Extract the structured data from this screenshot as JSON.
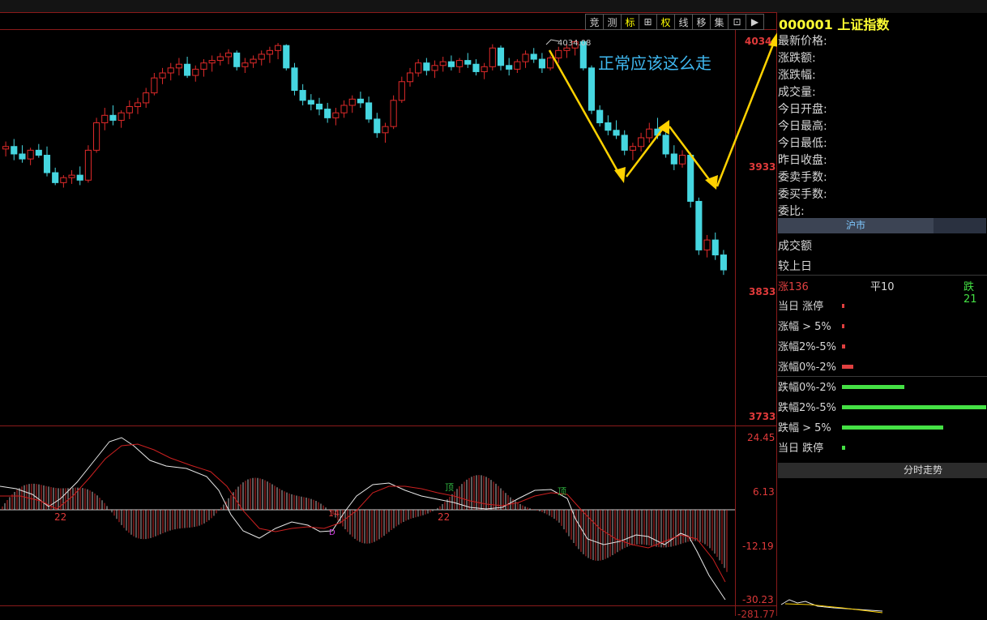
{
  "toolbar": {
    "buttons": [
      {
        "label": "竞",
        "active": false
      },
      {
        "label": "测",
        "active": false
      },
      {
        "label": "标",
        "active": true
      },
      {
        "label": "⊞",
        "active": false
      },
      {
        "label": "权",
        "active": true
      },
      {
        "label": "线",
        "active": false
      },
      {
        "label": "移",
        "active": false
      },
      {
        "label": "集",
        "active": false
      },
      {
        "label": "⊡",
        "active": false
      },
      {
        "label": "▶",
        "active": false
      }
    ]
  },
  "main_chart": {
    "price_axis": [
      "4034",
      "3933",
      "3833",
      "3733"
    ],
    "high_label": "4034.08",
    "annotation": "正常应该这么走"
  },
  "indicator": {
    "axis": [
      "24.45",
      "6.13",
      "-12.19",
      "-30.23",
      "-281.77"
    ],
    "markers": [
      "22",
      "14",
      "22",
      "D",
      "顶",
      "顶"
    ]
  },
  "panel": {
    "code": "000001",
    "name": "上证指数",
    "fields": [
      "最新价格:",
      "涨跌额:",
      "涨跌幅:",
      "成交量:",
      "今日开盘:",
      "今日最高:",
      "今日最低:",
      "昨日收盘:",
      "委卖手数:",
      "委买手数:",
      "委比:"
    ],
    "market_tab": "沪市",
    "turnover_label": "成交额",
    "compare_label": "较上日",
    "up_label": "涨136",
    "flat_label": "平10",
    "down_label": "跌21",
    "distribution": [
      {
        "label": "当日 涨停",
        "value": 1,
        "color": "#e04040"
      },
      {
        "label": "涨幅 > 5%",
        "value": 1,
        "color": "#e04040"
      },
      {
        "label": "涨幅2%-5%",
        "value": 4,
        "color": "#e04040"
      },
      {
        "label": "涨幅0%-2%",
        "value": 14,
        "color": "#e04040"
      },
      {
        "label": "跌幅0%-2%",
        "value": 78,
        "color": "#44e044"
      },
      {
        "label": "跌幅2%-5%",
        "value": 180,
        "color": "#44e044"
      },
      {
        "label": "跌幅 > 5%",
        "value": 126,
        "color": "#44e044"
      },
      {
        "label": "当日 跌停",
        "value": 4,
        "color": "#44e044"
      }
    ],
    "fenshi_label": "分时走势"
  },
  "colors": {
    "up": "#e02a2a",
    "down": "#46d6e0",
    "annotation_line": "#ffd200"
  },
  "chart_data": {
    "type": "candlestick",
    "title": "",
    "ylim": [
      3733,
      4034
    ],
    "y_ticks": [
      4034,
      3933,
      3833,
      3733
    ],
    "high": 4034.08,
    "candles": [
      [
        3947,
        3953,
        3941,
        3949
      ],
      [
        3949,
        3955,
        3938,
        3943
      ],
      [
        3943,
        3950,
        3936,
        3939
      ],
      [
        3939,
        3948,
        3934,
        3946
      ],
      [
        3946,
        3951,
        3940,
        3942
      ],
      [
        3942,
        3949,
        3925,
        3928
      ],
      [
        3928,
        3932,
        3918,
        3920
      ],
      [
        3920,
        3926,
        3916,
        3924
      ],
      [
        3924,
        3930,
        3919,
        3926
      ],
      [
        3926,
        3933,
        3918,
        3922
      ],
      [
        3922,
        3950,
        3920,
        3946
      ],
      [
        3946,
        3972,
        3944,
        3968
      ],
      [
        3968,
        3980,
        3962,
        3974
      ],
      [
        3974,
        3982,
        3966,
        3970
      ],
      [
        3970,
        3978,
        3964,
        3976
      ],
      [
        3976,
        3986,
        3971,
        3981
      ],
      [
        3981,
        3988,
        3975,
        3984
      ],
      [
        3984,
        3996,
        3980,
        3992
      ],
      [
        3992,
        4008,
        3990,
        4004
      ],
      [
        4004,
        4012,
        3999,
        4008
      ],
      [
        4008,
        4016,
        4002,
        4012
      ],
      [
        4012,
        4020,
        4006,
        4015
      ],
      [
        4015,
        4021,
        4004,
        4006
      ],
      [
        4006,
        4014,
        4001,
        4011
      ],
      [
        4011,
        4019,
        4005,
        4016
      ],
      [
        4016,
        4022,
        4009,
        4018
      ],
      [
        4018,
        4024,
        4014,
        4021
      ],
      [
        4021,
        4027,
        4015,
        4024
      ],
      [
        4024,
        4026,
        4010,
        4013
      ],
      [
        4013,
        4020,
        4008,
        4016
      ],
      [
        4016,
        4022,
        4012,
        4019
      ],
      [
        4019,
        4026,
        4014,
        4023
      ],
      [
        4023,
        4029,
        4016,
        4026
      ],
      [
        4026,
        4032,
        4019,
        4030
      ],
      [
        4030,
        4031,
        4010,
        4012
      ],
      [
        4012,
        4016,
        3990,
        3994
      ],
      [
        3994,
        3999,
        3982,
        3986
      ],
      [
        3986,
        3991,
        3978,
        3983
      ],
      [
        3983,
        3988,
        3974,
        3979
      ],
      [
        3979,
        3984,
        3968,
        3972
      ],
      [
        3972,
        3980,
        3966,
        3976
      ],
      [
        3976,
        3986,
        3972,
        3982
      ],
      [
        3982,
        3990,
        3976,
        3987
      ],
      [
        3987,
        3993,
        3980,
        3984
      ],
      [
        3984,
        3989,
        3968,
        3971
      ],
      [
        3971,
        3976,
        3956,
        3960
      ],
      [
        3960,
        3968,
        3952,
        3965
      ],
      [
        3965,
        3990,
        3963,
        3986
      ],
      [
        3986,
        4005,
        3984,
        4001
      ],
      [
        4001,
        4012,
        3997,
        4008
      ],
      [
        4008,
        4019,
        4005,
        4016
      ],
      [
        4016,
        4020,
        4006,
        4010
      ],
      [
        4010,
        4018,
        4004,
        4014
      ],
      [
        4014,
        4021,
        4009,
        4017
      ],
      [
        4017,
        4022,
        4010,
        4013
      ],
      [
        4013,
        4020,
        4008,
        4018
      ],
      [
        4018,
        4024,
        4012,
        4015
      ],
      [
        4015,
        4019,
        4006,
        4009
      ],
      [
        4009,
        4016,
        4003,
        4013
      ],
      [
        4013,
        4031,
        4010,
        4028
      ],
      [
        4028,
        4030,
        4010,
        4014
      ],
      [
        4014,
        4020,
        4006,
        4011
      ],
      [
        4011,
        4019,
        4008,
        4017
      ],
      [
        4017,
        4026,
        4012,
        4023
      ],
      [
        4023,
        4028,
        4016,
        4019
      ],
      [
        4019,
        4024,
        4008,
        4012
      ],
      [
        4012,
        4022,
        4010,
        4020
      ],
      [
        4020,
        4029,
        4016,
        4026
      ],
      [
        4026,
        4032,
        4020,
        4028
      ],
      [
        4028,
        4034,
        4022,
        4033
      ],
      [
        4033,
        4034,
        4010,
        4012
      ],
      [
        4012,
        4014,
        3975,
        3978
      ],
      [
        3978,
        3982,
        3965,
        3968
      ],
      [
        3968,
        3974,
        3958,
        3962
      ],
      [
        3962,
        3970,
        3955,
        3958
      ],
      [
        3958,
        3962,
        3942,
        3946
      ],
      [
        3946,
        3952,
        3938,
        3949
      ],
      [
        3949,
        3960,
        3945,
        3956
      ],
      [
        3956,
        3968,
        3952,
        3963
      ],
      [
        3963,
        3972,
        3955,
        3958
      ],
      [
        3958,
        3962,
        3940,
        3943
      ],
      [
        3943,
        3950,
        3930,
        3935
      ],
      [
        3935,
        3946,
        3932,
        3942
      ],
      [
        3942,
        3944,
        3900,
        3905
      ],
      [
        3905,
        3908,
        3862,
        3866
      ],
      [
        3866,
        3878,
        3860,
        3874
      ],
      [
        3874,
        3880,
        3858,
        3862
      ],
      [
        3862,
        3866,
        3846,
        3850
      ]
    ],
    "annotation_path": "4034 → 3929 → 3966 → 3924 → 4034 (drawn arrows)"
  }
}
